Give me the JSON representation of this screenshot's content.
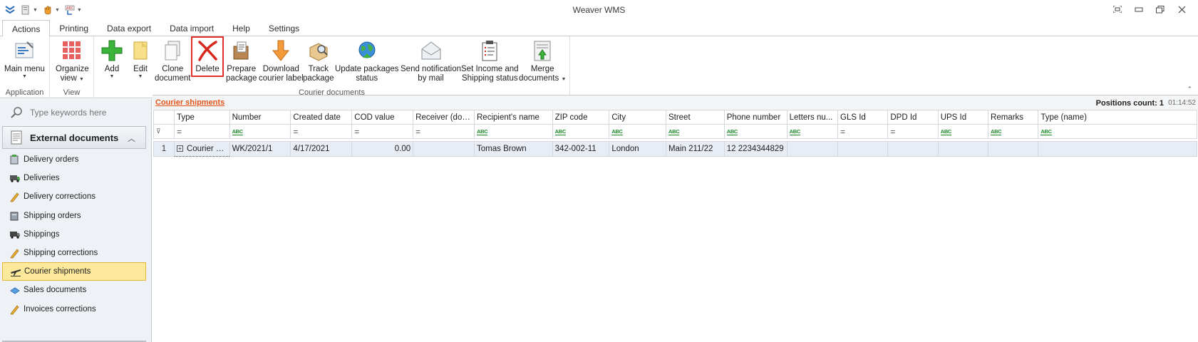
{
  "window": {
    "title": "Weaver WMS"
  },
  "ribbon_tabs": [
    {
      "label": "Actions",
      "active": true
    },
    {
      "label": "Printing"
    },
    {
      "label": "Data export"
    },
    {
      "label": "Data import"
    },
    {
      "label": "Help"
    },
    {
      "label": "Settings"
    }
  ],
  "ribbon": {
    "groups": {
      "application": "Application",
      "view": "View",
      "courier_documents": "Courier documents"
    },
    "buttons": {
      "main_menu": {
        "line1": "Main menu",
        "line2": ""
      },
      "organize_view": {
        "line1": "Organize",
        "line2": "view"
      },
      "add": {
        "line1": "Add",
        "line2": ""
      },
      "edit": {
        "line1": "Edit",
        "line2": ""
      },
      "clone": {
        "line1": "Clone",
        "line2": "document"
      },
      "delete": {
        "line1": "Delete",
        "line2": ""
      },
      "prepare": {
        "line1": "Prepare",
        "line2": "package"
      },
      "download": {
        "line1": "Download",
        "line2": "courier label"
      },
      "track": {
        "line1": "Track",
        "line2": "package"
      },
      "update": {
        "line1": "Update packages",
        "line2": "status"
      },
      "notify": {
        "line1": "Send notification",
        "line2": "by mail"
      },
      "income": {
        "line1": "Set Income and",
        "line2": "Shipping status"
      },
      "merge": {
        "line1": "Merge",
        "line2": "documents"
      }
    }
  },
  "nav": {
    "search_placeholder": "Type keywords here",
    "group_label": "External documents",
    "items": [
      {
        "label": "Delivery orders",
        "icon": "delivery-orders-icon"
      },
      {
        "label": "Deliveries",
        "icon": "truck-icon"
      },
      {
        "label": "Delivery corrections",
        "icon": "pencil-icon"
      },
      {
        "label": "Shipping orders",
        "icon": "shipping-orders-icon"
      },
      {
        "label": "Shippings",
        "icon": "truck-icon"
      },
      {
        "label": "Shipping corrections",
        "icon": "pencil-icon"
      },
      {
        "label": "Courier shipments",
        "icon": "plane-icon",
        "selected": true
      },
      {
        "label": "Sales documents",
        "icon": "sales-icon"
      },
      {
        "label": "Invoices corrections",
        "icon": "pencil-icon"
      }
    ]
  },
  "grid": {
    "title": "Courier shipments",
    "positions_count": "Positions count: 1",
    "time": "01:14:52",
    "columns": [
      "Type",
      "Number",
      "Created date",
      "COD value",
      "Receiver (docu...",
      "Recipient's name",
      "ZIP code",
      "City",
      "Street",
      "Phone number",
      "Letters nu...",
      "GLS Id",
      "DPD Id",
      "UPS Id",
      "Remarks",
      "Type (name)"
    ],
    "filter_abc": "ABC",
    "filter_eq": "=",
    "filter_funnel": "⊽",
    "rows": [
      {
        "index": "1",
        "type": "Courier do...",
        "number": "WK/2021/1",
        "created_date": "4/17/2021",
        "cod_value": "0.00",
        "receiver": "",
        "recipient_name": "Tomas Brown",
        "zip": "342-002-11",
        "city": "London",
        "street": "Main 211/22",
        "phone": "12 2234344829",
        "letters": "",
        "gls": "",
        "dpd": "",
        "ups": "",
        "remarks": "",
        "type_name": ""
      }
    ]
  },
  "colors": {
    "accent_orange": "#e2541a",
    "selected_nav_bg": "#fde99b",
    "highlight_red": "#e0302a"
  }
}
